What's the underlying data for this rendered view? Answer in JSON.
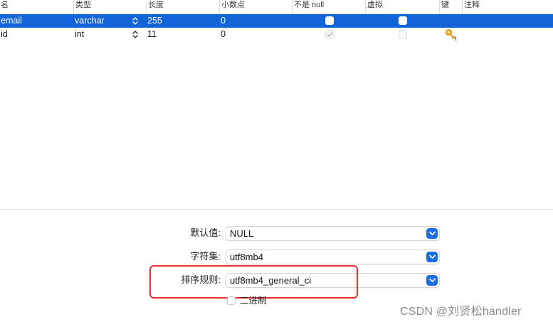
{
  "table": {
    "columns": [
      "名",
      "类型",
      "长度",
      "小数点",
      "不是 null",
      "虚拟",
      "键",
      "注释"
    ],
    "rows": [
      {
        "name": "email",
        "type": "varchar",
        "length": "255",
        "decimals": "0",
        "not_null": false,
        "virtual": false,
        "key": false,
        "comment": "",
        "selected": true
      },
      {
        "name": "id",
        "type": "int",
        "length": "11",
        "decimals": "0",
        "not_null": true,
        "virtual": false,
        "key": true,
        "comment": "",
        "selected": false
      }
    ]
  },
  "properties": {
    "default_label": "默认值:",
    "default_value": "NULL",
    "charset_label": "字符集:",
    "charset_value": "utf8mb4",
    "collation_label": "排序规则:",
    "collation_value": "utf8mb4_general_ci",
    "binary_label": "二进制",
    "binary_checked": false
  },
  "watermark": "CSDN @刘贤松handler",
  "colors": {
    "selection": "#1364d8",
    "select_arrow": "#1d6fe0",
    "highlight_border": "#e8312b",
    "key_icon": "#e8a415"
  }
}
